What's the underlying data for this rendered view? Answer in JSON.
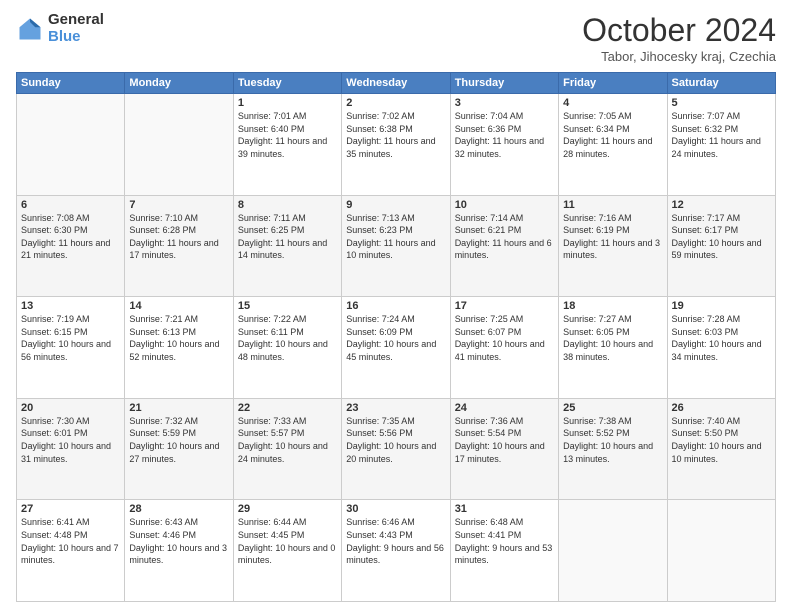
{
  "logo": {
    "general": "General",
    "blue": "Blue"
  },
  "header": {
    "month": "October 2024",
    "location": "Tabor, Jihocesky kraj, Czechia"
  },
  "weekdays": [
    "Sunday",
    "Monday",
    "Tuesday",
    "Wednesday",
    "Thursday",
    "Friday",
    "Saturday"
  ],
  "weeks": [
    [
      {
        "day": "",
        "info": ""
      },
      {
        "day": "",
        "info": ""
      },
      {
        "day": "1",
        "info": "Sunrise: 7:01 AM\nSunset: 6:40 PM\nDaylight: 11 hours and 39 minutes."
      },
      {
        "day": "2",
        "info": "Sunrise: 7:02 AM\nSunset: 6:38 PM\nDaylight: 11 hours and 35 minutes."
      },
      {
        "day": "3",
        "info": "Sunrise: 7:04 AM\nSunset: 6:36 PM\nDaylight: 11 hours and 32 minutes."
      },
      {
        "day": "4",
        "info": "Sunrise: 7:05 AM\nSunset: 6:34 PM\nDaylight: 11 hours and 28 minutes."
      },
      {
        "day": "5",
        "info": "Sunrise: 7:07 AM\nSunset: 6:32 PM\nDaylight: 11 hours and 24 minutes."
      }
    ],
    [
      {
        "day": "6",
        "info": "Sunrise: 7:08 AM\nSunset: 6:30 PM\nDaylight: 11 hours and 21 minutes."
      },
      {
        "day": "7",
        "info": "Sunrise: 7:10 AM\nSunset: 6:28 PM\nDaylight: 11 hours and 17 minutes."
      },
      {
        "day": "8",
        "info": "Sunrise: 7:11 AM\nSunset: 6:25 PM\nDaylight: 11 hours and 14 minutes."
      },
      {
        "day": "9",
        "info": "Sunrise: 7:13 AM\nSunset: 6:23 PM\nDaylight: 11 hours and 10 minutes."
      },
      {
        "day": "10",
        "info": "Sunrise: 7:14 AM\nSunset: 6:21 PM\nDaylight: 11 hours and 6 minutes."
      },
      {
        "day": "11",
        "info": "Sunrise: 7:16 AM\nSunset: 6:19 PM\nDaylight: 11 hours and 3 minutes."
      },
      {
        "day": "12",
        "info": "Sunrise: 7:17 AM\nSunset: 6:17 PM\nDaylight: 10 hours and 59 minutes."
      }
    ],
    [
      {
        "day": "13",
        "info": "Sunrise: 7:19 AM\nSunset: 6:15 PM\nDaylight: 10 hours and 56 minutes."
      },
      {
        "day": "14",
        "info": "Sunrise: 7:21 AM\nSunset: 6:13 PM\nDaylight: 10 hours and 52 minutes."
      },
      {
        "day": "15",
        "info": "Sunrise: 7:22 AM\nSunset: 6:11 PM\nDaylight: 10 hours and 48 minutes."
      },
      {
        "day": "16",
        "info": "Sunrise: 7:24 AM\nSunset: 6:09 PM\nDaylight: 10 hours and 45 minutes."
      },
      {
        "day": "17",
        "info": "Sunrise: 7:25 AM\nSunset: 6:07 PM\nDaylight: 10 hours and 41 minutes."
      },
      {
        "day": "18",
        "info": "Sunrise: 7:27 AM\nSunset: 6:05 PM\nDaylight: 10 hours and 38 minutes."
      },
      {
        "day": "19",
        "info": "Sunrise: 7:28 AM\nSunset: 6:03 PM\nDaylight: 10 hours and 34 minutes."
      }
    ],
    [
      {
        "day": "20",
        "info": "Sunrise: 7:30 AM\nSunset: 6:01 PM\nDaylight: 10 hours and 31 minutes."
      },
      {
        "day": "21",
        "info": "Sunrise: 7:32 AM\nSunset: 5:59 PM\nDaylight: 10 hours and 27 minutes."
      },
      {
        "day": "22",
        "info": "Sunrise: 7:33 AM\nSunset: 5:57 PM\nDaylight: 10 hours and 24 minutes."
      },
      {
        "day": "23",
        "info": "Sunrise: 7:35 AM\nSunset: 5:56 PM\nDaylight: 10 hours and 20 minutes."
      },
      {
        "day": "24",
        "info": "Sunrise: 7:36 AM\nSunset: 5:54 PM\nDaylight: 10 hours and 17 minutes."
      },
      {
        "day": "25",
        "info": "Sunrise: 7:38 AM\nSunset: 5:52 PM\nDaylight: 10 hours and 13 minutes."
      },
      {
        "day": "26",
        "info": "Sunrise: 7:40 AM\nSunset: 5:50 PM\nDaylight: 10 hours and 10 minutes."
      }
    ],
    [
      {
        "day": "27",
        "info": "Sunrise: 6:41 AM\nSunset: 4:48 PM\nDaylight: 10 hours and 7 minutes."
      },
      {
        "day": "28",
        "info": "Sunrise: 6:43 AM\nSunset: 4:46 PM\nDaylight: 10 hours and 3 minutes."
      },
      {
        "day": "29",
        "info": "Sunrise: 6:44 AM\nSunset: 4:45 PM\nDaylight: 10 hours and 0 minutes."
      },
      {
        "day": "30",
        "info": "Sunrise: 6:46 AM\nSunset: 4:43 PM\nDaylight: 9 hours and 56 minutes."
      },
      {
        "day": "31",
        "info": "Sunrise: 6:48 AM\nSunset: 4:41 PM\nDaylight: 9 hours and 53 minutes."
      },
      {
        "day": "",
        "info": ""
      },
      {
        "day": "",
        "info": ""
      }
    ]
  ]
}
